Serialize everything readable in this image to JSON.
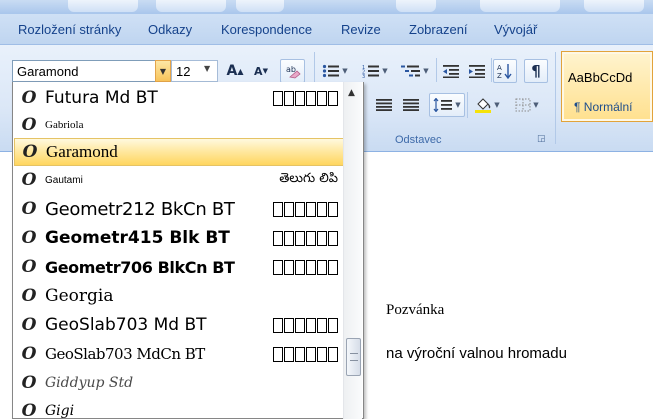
{
  "tabs": [
    "Rozložení stránky",
    "Odkazy",
    "Korespondence",
    "Revize",
    "Zobrazení",
    "Vývojář"
  ],
  "font": {
    "current": "Garamond",
    "size": "12"
  },
  "ribbon": {
    "paragraph_group_label": "Odstavec"
  },
  "styles": {
    "sample": "AaBbCcDd",
    "name": "¶ Normální"
  },
  "font_list": {
    "icon": "opentype-icon",
    "items": [
      {
        "name": "Futura Md BT",
        "sample": "boxes"
      },
      {
        "name": "Gabriola",
        "sample": ""
      },
      {
        "name": "Garamond",
        "sample": "",
        "selected": true
      },
      {
        "name": "Gautami",
        "sample": "తెలుగు లిపి"
      },
      {
        "name": "Geometr212 BkCn BT",
        "sample": "boxes"
      },
      {
        "name": "Geometr415 Blk BT",
        "sample": "boxes"
      },
      {
        "name": "Geometr706 BlkCn BT",
        "sample": "boxes"
      },
      {
        "name": "Georgia",
        "sample": ""
      },
      {
        "name": "GeoSlab703 Md BT",
        "sample": "boxes"
      },
      {
        "name": "GeoSlab703 MdCn BT",
        "sample": "boxes"
      },
      {
        "name": "Giddyup Std",
        "sample": ""
      },
      {
        "name": "Gigi",
        "sample": ""
      }
    ]
  },
  "document": {
    "title": "Pozvánka",
    "line": "na výroční valnou hromadu"
  },
  "colors": {
    "ribbon_text": "#15428b",
    "selection": "#ffd65f",
    "group_label": "#3e6aa9"
  }
}
